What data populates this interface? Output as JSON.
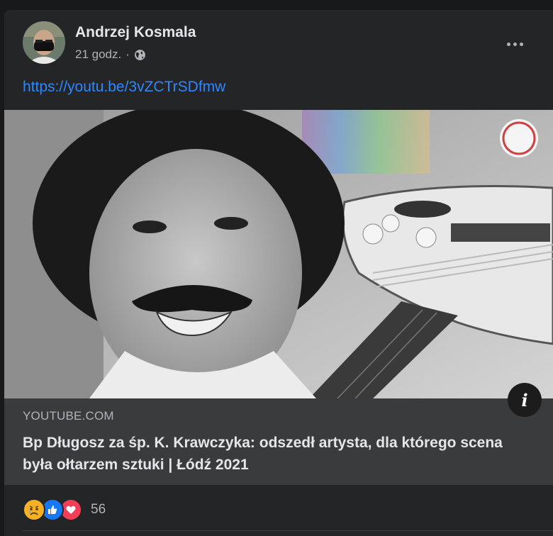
{
  "post": {
    "author": "Andrzej Kosmala",
    "time": "21 godz.",
    "separator": "·",
    "privacy_icon": "globe-icon",
    "link_text": "https://youtu.be/3vZCTrSDfmw"
  },
  "link_preview": {
    "domain": "YOUTUBE.COM",
    "title": "Bp Długosz za śp. K. Krawczyka: odszedł artysta, dla którego scena była ołtarzem sztuki | Łódź 2021",
    "info_icon": "i"
  },
  "reactions": {
    "icons": [
      "sad-reaction-icon",
      "like-reaction-icon",
      "love-reaction-icon"
    ],
    "count": "56"
  },
  "colors": {
    "background": "#18191a",
    "card": "#242526",
    "link": "#2d88ff",
    "like": "#1877f2",
    "love": "#f33e58",
    "sad": "#f7b125"
  }
}
